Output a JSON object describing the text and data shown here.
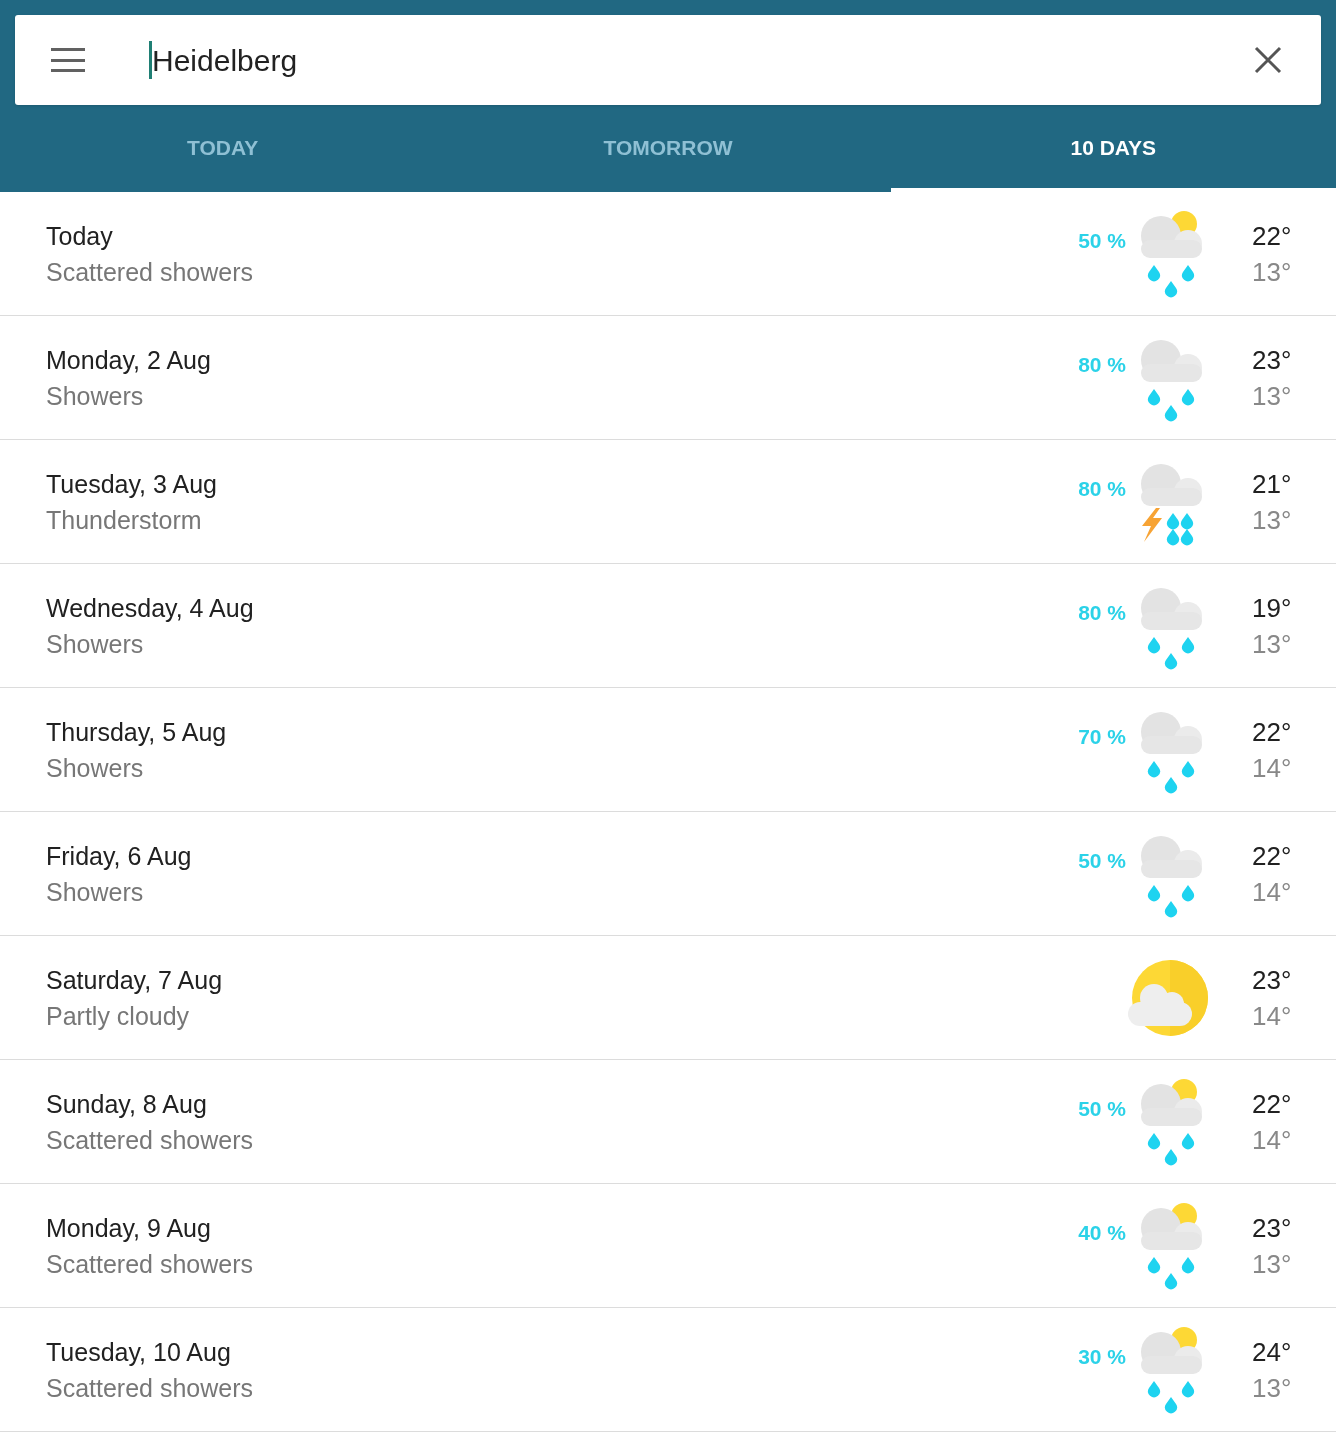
{
  "search": {
    "value": "Heidelberg"
  },
  "tabs": [
    {
      "label": "TODAY",
      "selected": false
    },
    {
      "label": "TOMORROW",
      "selected": false
    },
    {
      "label": "10 DAYS",
      "selected": true
    }
  ],
  "days": [
    {
      "day": "Today",
      "condition": "Scattered showers",
      "precipitation": "50 %",
      "kind": "sun_showers",
      "high": "22°",
      "low": "13°"
    },
    {
      "day": "Monday, 2 Aug",
      "condition": "Showers",
      "precipitation": "80 %",
      "kind": "showers",
      "high": "23°",
      "low": "13°"
    },
    {
      "day": "Tuesday, 3 Aug",
      "condition": "Thunderstorm",
      "precipitation": "80 %",
      "kind": "thunderstorm",
      "high": "21°",
      "low": "13°"
    },
    {
      "day": "Wednesday, 4 Aug",
      "condition": "Showers",
      "precipitation": "80 %",
      "kind": "showers",
      "high": "19°",
      "low": "13°"
    },
    {
      "day": "Thursday, 5 Aug",
      "condition": "Showers",
      "precipitation": "70 %",
      "kind": "showers",
      "high": "22°",
      "low": "14°"
    },
    {
      "day": "Friday, 6 Aug",
      "condition": "Showers",
      "precipitation": "50 %",
      "kind": "showers",
      "high": "22°",
      "low": "14°"
    },
    {
      "day": "Saturday, 7 Aug",
      "condition": "Partly cloudy",
      "kind": "partly_cloudy",
      "high": "23°",
      "low": "14°"
    },
    {
      "day": "Sunday, 8 Aug",
      "condition": "Scattered showers",
      "precipitation": "50 %",
      "kind": "sun_showers",
      "high": "22°",
      "low": "14°"
    },
    {
      "day": "Monday, 9 Aug",
      "condition": "Scattered showers",
      "precipitation": "40 %",
      "kind": "sun_showers",
      "high": "23°",
      "low": "13°"
    },
    {
      "day": "Tuesday, 10 Aug",
      "condition": "Scattered showers",
      "precipitation": "30 %",
      "kind": "sun_showers",
      "high": "24°",
      "low": "13°"
    }
  ]
}
